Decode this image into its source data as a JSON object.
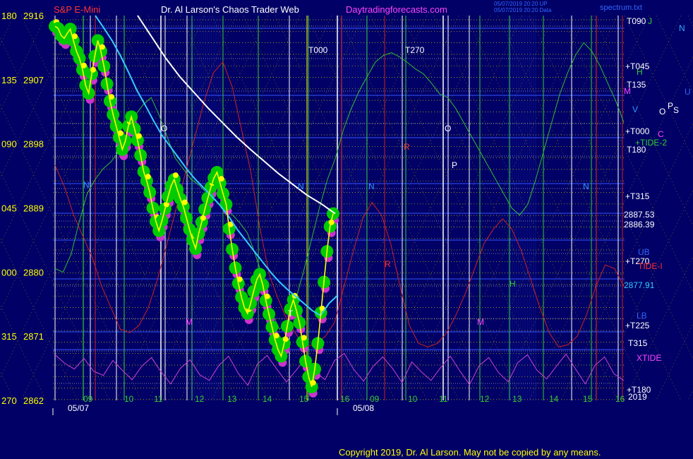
{
  "header": {
    "symbol": "S&P E-Mini",
    "title": "Dr. Al Larson's Chaos Trader Web",
    "site": "Daytradingforecasts.com",
    "stamp1": "05/07/2019 20:20 UP",
    "stamp2": "05/07/2019 20:20 Data",
    "file": "spectrum.txt"
  },
  "footer": {
    "copyright": "Copyright 2019, Dr. Al Larson. May not be copied by any means."
  },
  "colors": {
    "background": "#000066",
    "price_bar": "#ffff00",
    "green_dots": "#00cc00",
    "magenta_dots": "#cc33cc",
    "avg_cyan": "#33ccff",
    "avg_white": "#ffffff",
    "red_line": "#cc2222",
    "green_line": "#33bb33",
    "magenta_line": "#cc44cc"
  },
  "chart_data": {
    "type": "line",
    "ylim": [
      2862,
      2916
    ],
    "y_axis_left": [
      {
        "angle": "180",
        "price": "2916"
      },
      {
        "angle": "135",
        "price": "2907"
      },
      {
        "angle": "090",
        "price": "2898"
      },
      {
        "angle": "045",
        "price": "2889"
      },
      {
        "angle": "000",
        "price": "2880"
      },
      {
        "angle": "315",
        "price": "2871"
      },
      {
        "angle": "270",
        "price": "2862"
      }
    ],
    "x_date_labels": [
      "05/07",
      "05/08"
    ],
    "x_hour_labels": [
      "09",
      "10",
      "11",
      "12",
      "13",
      "14",
      "15",
      "16",
      "09",
      "10",
      "11",
      "12",
      "13",
      "14",
      "15",
      "16"
    ],
    "right_labels": [
      {
        "text": "T090",
        "color": "#ffffff"
      },
      {
        "text": "J",
        "color": "#33cc33"
      },
      {
        "text": "N",
        "color": "#33aaff"
      },
      {
        "text": "+T045",
        "color": "#ffffff"
      },
      {
        "text": "H",
        "color": "#33cc33"
      },
      {
        "text": "T135",
        "color": "#ffffff"
      },
      {
        "text": "M",
        "color": "#ff44ff"
      },
      {
        "text": "U",
        "color": "#3366ff"
      },
      {
        "text": "V",
        "color": "#3399ff"
      },
      {
        "text": "O",
        "color": "#ffffff"
      },
      {
        "text": "P",
        "color": "#ffffff"
      },
      {
        "text": "S",
        "color": "#ffffff"
      },
      {
        "text": "+T000",
        "color": "#ffffff"
      },
      {
        "text": "C",
        "color": "#ff44ff"
      },
      {
        "text": "+TIDE-2",
        "color": "#33cc33"
      },
      {
        "text": "T180",
        "color": "#ffffff"
      },
      {
        "text": "+T315",
        "color": "#ffffff"
      },
      {
        "text": "2887.53",
        "color": "#ffffff"
      },
      {
        "text": "2886.39",
        "color": "#ffffff"
      },
      {
        "text": "UB",
        "color": "#3366ff"
      },
      {
        "text": "+T270",
        "color": "#ffffff"
      },
      {
        "text": "TIDE-I",
        "color": "#ff3333"
      },
      {
        "text": "2877.91",
        "color": "#33ccff"
      },
      {
        "text": "LB",
        "color": "#3366ff"
      },
      {
        "text": "+T225",
        "color": "#ffffff"
      },
      {
        "text": "T315",
        "color": "#ffffff"
      },
      {
        "text": "XTIDE",
        "color": "#ff44ff"
      },
      {
        "text": "+T180",
        "color": "#ffffff"
      },
      {
        "text": "2019",
        "color": "#ffffff"
      }
    ],
    "chart_markers": [
      "T000",
      "T270",
      "O",
      "O",
      "P",
      "N",
      "N",
      "N",
      "N",
      "M",
      "M",
      "H",
      "R",
      "R",
      "T"
    ],
    "price_series": [
      2914.5,
      2914.2,
      2913.2,
      2912.8,
      2913.5,
      2914.1,
      2912.5,
      2911.0,
      2910.0,
      2908.4,
      2906.2,
      2905.1,
      2907.8,
      2910.3,
      2912.5,
      2911.0,
      2908.9,
      2906.4,
      2904.0,
      2902.1,
      2900.5,
      2898.9,
      2897.2,
      2898.4,
      2900.5,
      2901.8,
      2900.1,
      2898.5,
      2896.4,
      2894.1,
      2892.8,
      2891.2,
      2889.0,
      2887.1,
      2885.8,
      2887.2,
      2888.9,
      2890.6,
      2892.1,
      2893.0,
      2891.6,
      2890.3,
      2889.2,
      2887.6,
      2886.0,
      2884.5,
      2883.3,
      2885.4,
      2887.0,
      2888.8,
      2890.4,
      2891.9,
      2893.2,
      2894.0,
      2892.5,
      2891.0,
      2889.5,
      2886.1,
      2883.2,
      2880.6,
      2878.4,
      2876.5,
      2875.0,
      2874.2,
      2875.6,
      2877.3,
      2878.9,
      2879.7,
      2878.2,
      2876.0,
      2874.1,
      2872.3,
      2870.5,
      2869.1,
      2868.2,
      2870.0,
      2872.4,
      2874.8,
      2876.1,
      2874.6,
      2872.9,
      2870.2,
      2867.5,
      2865.3,
      2863.9,
      2866.4,
      2870.0,
      2874.3,
      2878.6,
      2882.9,
      2886.4,
      2888.2
    ],
    "cyan_avg": [
      2916.0,
      2914.3,
      2912.5,
      2910.4,
      2908.0,
      2905.5,
      2903.4,
      2901.2,
      2899.2,
      2897.6,
      2896.0,
      2894.4,
      2893.0,
      2891.8,
      2890.6,
      2889.3,
      2887.8,
      2886.0,
      2884.5,
      2883.0,
      2881.5,
      2880.0,
      2878.7,
      2877.6,
      2876.6,
      2875.6,
      2874.6,
      2873.9,
      2875.6,
      2876.7
    ],
    "white_avg": [
      2916.0,
      2913.0,
      2910.0,
      2907.4,
      2905.2,
      2903.0,
      2901.0,
      2899.0,
      2897.2,
      2895.5,
      2893.8,
      2892.3,
      2890.8,
      2889.6,
      2888.2
    ],
    "green_osc": [
      2880.5,
      2880.0,
      2882.5,
      2887.0,
      2891.0,
      2893.0,
      2894.5,
      2895.5,
      2897.0,
      2899.5,
      2902.0,
      2903.5,
      2904.5,
      2902.0,
      2899.0,
      2896.0,
      2894.5,
      2893.0,
      2892.2,
      2891.0,
      2890.0,
      2889.0,
      2888.2,
      2887.0,
      2885.5,
      2882.5,
      2879.0,
      2874.5,
      2872.0,
      2872.8,
      2876.0,
      2880.0,
      2884.5,
      2889.0,
      2893.0,
      2896.0,
      2900.0,
      2903.0,
      2905.5,
      2907.5,
      2909.5,
      2910.4,
      2910.8,
      2910.2,
      2909.4,
      2908.5,
      2907.8,
      2906.5,
      2905.0,
      2904.5,
      2903.0,
      2901.0,
      2899.0,
      2897.0,
      2895.0,
      2893.0,
      2891.0,
      2889.0,
      2888.0,
      2889.5,
      2893.0,
      2897.0,
      2901.0,
      2905.0,
      2908.0,
      2910.5,
      2912.2,
      2911.0,
      2909.0,
      2906.5,
      2904.0,
      2901.0
    ],
    "red_osc": [
      2895.0,
      2892.0,
      2888.0,
      2885.0,
      2882.0,
      2878.0,
      2875.0,
      2872.0,
      2871.5,
      2872.5,
      2875.0,
      2879.0,
      2884.0,
      2889.0,
      2894.0,
      2899.0,
      2904.0,
      2908.0,
      2909.5,
      2906.0,
      2900.0,
      2894.0,
      2886.0,
      2879.5,
      2876.0,
      2873.0,
      2871.0,
      2869.5,
      2870.0,
      2871.0,
      2873.0,
      2878.0,
      2883.0,
      2887.5,
      2889.8,
      2888.0,
      2884.0,
      2878.0,
      2872.5,
      2870.0,
      2869.5,
      2870.0,
      2871.5,
      2874.0,
      2877.0,
      2880.5,
      2884.0,
      2886.0,
      2887.5,
      2886.0,
      2883.0,
      2879.0,
      2875.0,
      2871.5,
      2869.5,
      2869.8,
      2871.0,
      2874.0,
      2878.0,
      2881.0,
      2880.5,
      2878.0
    ],
    "mag_osc": [
      2868.4,
      2867.2,
      2866.4,
      2867.9,
      2866.1,
      2865.5,
      2867.6,
      2866.2,
      2864.9,
      2866.8,
      2868.0,
      2866.0,
      2864.3,
      2866.5,
      2867.7,
      2865.6,
      2864.8,
      2866.9,
      2868.2,
      2865.8,
      2864.1,
      2867.1,
      2868.3,
      2866.4,
      2864.6,
      2866.2,
      2867.9,
      2866.0,
      2864.9,
      2867.6,
      2868.6,
      2866.3,
      2864.7,
      2866.8,
      2868.1,
      2866.5,
      2864.5,
      2867.4,
      2866.0,
      2864.8,
      2866.6,
      2868.2,
      2866.1,
      2864.2,
      2866.9,
      2868.0,
      2865.9,
      2864.6,
      2867.3,
      2868.4,
      2866.2,
      2865.0,
      2866.8,
      2868.5,
      2866.4,
      2864.3,
      2866.9,
      2868.1,
      2865.7,
      2864.8
    ]
  }
}
